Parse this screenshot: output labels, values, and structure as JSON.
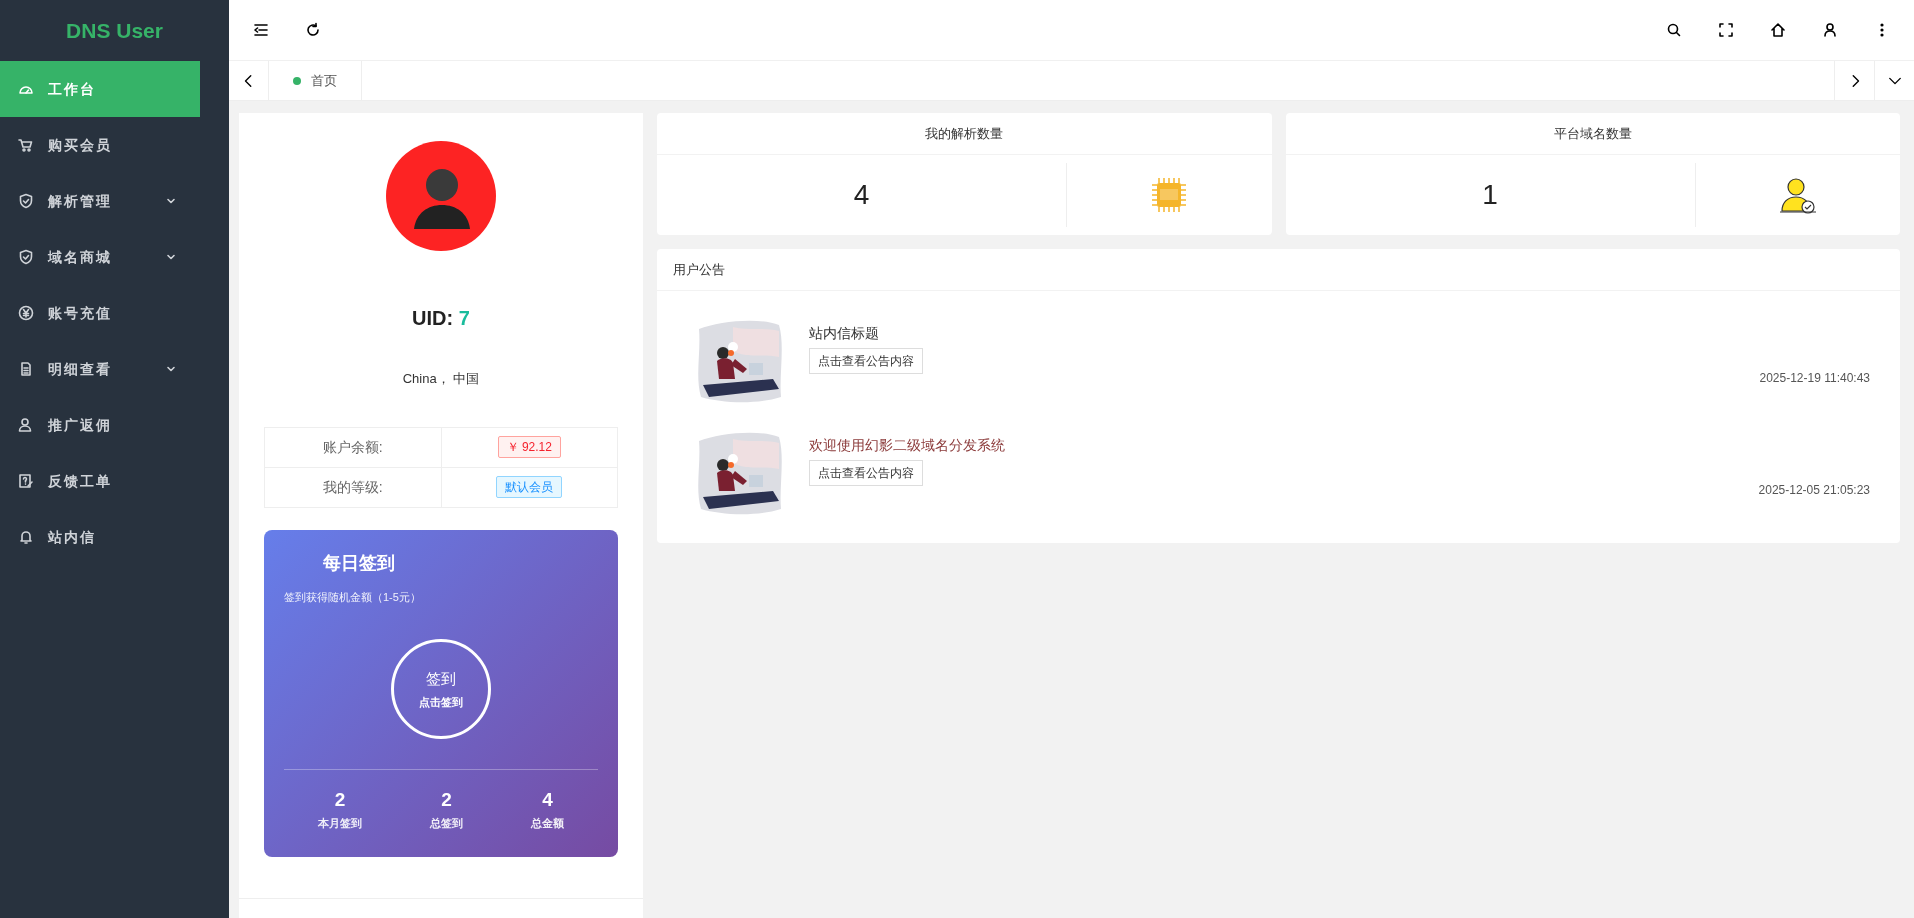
{
  "sidebar": {
    "logo": "DNS User",
    "items": [
      {
        "label": "工作台",
        "selected": true,
        "has_submenu": false
      },
      {
        "label": "购买会员",
        "selected": false,
        "has_submenu": false
      },
      {
        "label": "解析管理",
        "selected": false,
        "has_submenu": true
      },
      {
        "label": "域名商城",
        "selected": false,
        "has_submenu": true
      },
      {
        "label": "账号充值",
        "selected": false,
        "has_submenu": false
      },
      {
        "label": "明细查看",
        "selected": false,
        "has_submenu": true
      },
      {
        "label": "推广返佣",
        "selected": false,
        "has_submenu": false
      },
      {
        "label": "反馈工单",
        "selected": false,
        "has_submenu": false
      },
      {
        "label": "站内信",
        "selected": false,
        "has_submenu": false
      }
    ]
  },
  "tabs": [
    {
      "label": "首页",
      "selected": true
    }
  ],
  "profile": {
    "uid_label": "UID:",
    "uid": "7",
    "location": "China，  中国",
    "rows": [
      {
        "label": "账户余额:",
        "value": "￥ 92.12",
        "kind": "danger"
      },
      {
        "label": "我的等级:",
        "value": "默认会员",
        "kind": "info"
      }
    ]
  },
  "checkin": {
    "title": "每日签到",
    "subtitle": "签到获得随机金额（1-5元）",
    "button_title": "签到",
    "button_hint": "点击签到",
    "stats": [
      {
        "value": "2",
        "label": "本月签到"
      },
      {
        "value": "2",
        "label": "总签到"
      },
      {
        "value": "4",
        "label": "总金额"
      }
    ]
  },
  "stats_cards": [
    {
      "title": "我的解析数量",
      "value": "4",
      "kind": "api"
    },
    {
      "title": "平台域名数量",
      "value": "1",
      "kind": "user"
    }
  ],
  "announcements": {
    "title": "用户公告",
    "items": [
      {
        "title": "站内信标题",
        "button": "点击查看公告内容",
        "time": "2025-12-19 11:40:43",
        "color": "#333333"
      },
      {
        "title": "欢迎使用幻影二级域名分发系统",
        "button": "点击查看公告内容",
        "time": "2025-12-05 21:05:23",
        "color": "#8b3a3a"
      }
    ]
  }
}
